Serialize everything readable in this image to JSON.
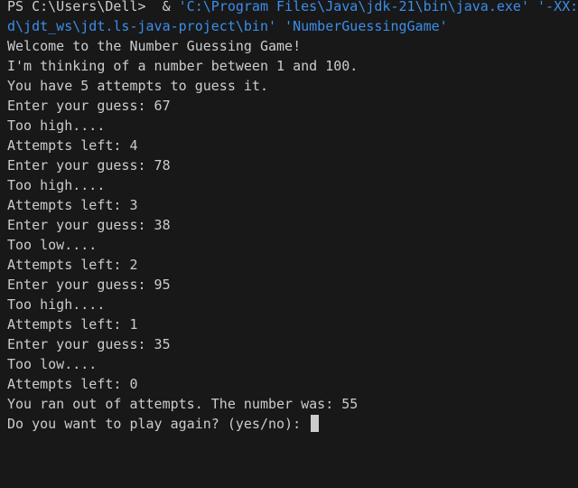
{
  "prompt": {
    "ps_prefix": "PS C:\\Users\\Dell>  & ",
    "java_exe": "'C:\\Program Files\\Java\\jdk-21\\bin\\java.exe' '-XX:+ShowCodeDetailsInExceptionMessages' '-cp' 'C:\\Users\\Dell\\AppData\\Roaming\\Code\\User\\workspaceStorage",
    "classpath_tail": "d\\jdt_ws\\jdt.ls-java-project\\bin'",
    "main_class": " 'NumberGuessingGame'"
  },
  "output_lines": [
    "Welcome to the Number Guessing Game!",
    "I'm thinking of a number between 1 and 100.",
    "You have 5 attempts to guess it.",
    "Enter your guess: 67",
    "Too high....",
    "Attempts left: 4",
    "Enter your guess: 78",
    "Too high....",
    "Attempts left: 3",
    "Enter your guess: 38",
    "Too low....",
    "Attempts left: 2",
    "Enter your guess: 95",
    "Too high....",
    "Attempts left: 1",
    "Enter your guess: 35",
    "Too low....",
    "Attempts left: 0",
    "You ran out of attempts. The number was: 55"
  ],
  "input_prompt": "Do you want to play again? (yes/no): ",
  "colors": {
    "background": "#181818",
    "text": "#cccccc",
    "path": "#3b8eea"
  }
}
